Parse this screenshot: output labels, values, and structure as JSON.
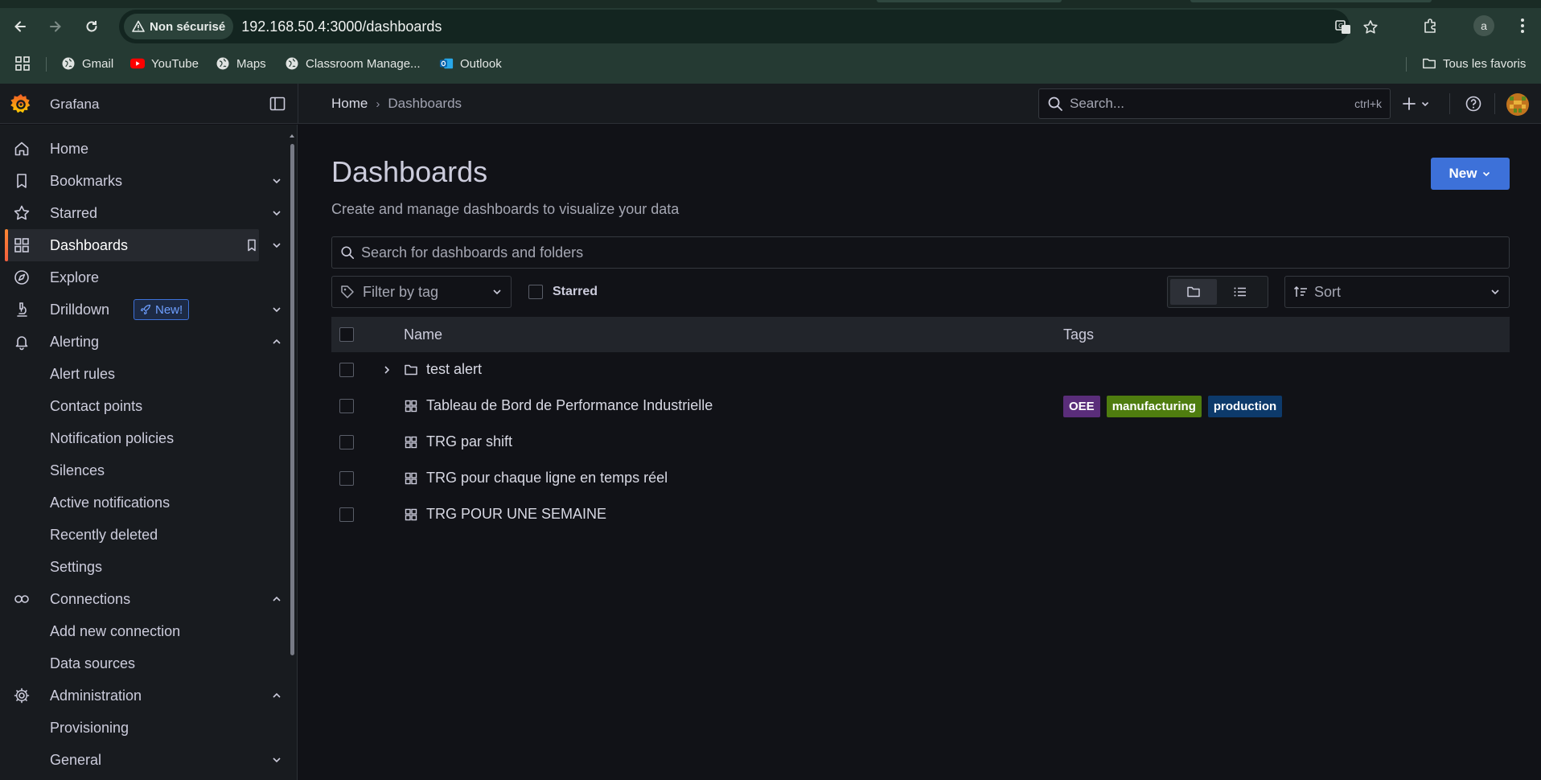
{
  "browser": {
    "security_label": "Non sécurisé",
    "url": "192.168.50.4:3000/dashboards",
    "profile_initial": "a",
    "bookmarks": [
      {
        "label": "Gmail",
        "icon": "globe-icon"
      },
      {
        "label": "YouTube",
        "icon": "youtube-icon"
      },
      {
        "label": "Maps",
        "icon": "globe-icon"
      },
      {
        "label": "Classroom Manage...",
        "icon": "globe-icon"
      },
      {
        "label": "Outlook",
        "icon": "outlook-icon"
      }
    ],
    "all_bookmarks_label": "Tous les favoris"
  },
  "grafana": {
    "app_name": "Grafana",
    "breadcrumb": {
      "home": "Home",
      "current": "Dashboards"
    },
    "search": {
      "placeholder": "Search...",
      "shortcut": "ctrl+k"
    },
    "accent_color": "#3d71d9"
  },
  "sidebar": {
    "items": [
      {
        "label": "Home",
        "icon": "home-icon"
      },
      {
        "label": "Bookmarks",
        "icon": "bookmark-icon"
      },
      {
        "label": "Starred",
        "icon": "star-icon"
      },
      {
        "label": "Dashboards",
        "icon": "apps-icon",
        "active": true
      },
      {
        "label": "Explore",
        "icon": "compass-icon"
      },
      {
        "label": "Drilldown",
        "icon": "microscope-icon",
        "badge": "New!"
      },
      {
        "label": "Alerting",
        "icon": "bell-icon"
      },
      {
        "label": "Connections",
        "icon": "connections-icon"
      },
      {
        "label": "Administration",
        "icon": "cog-icon"
      }
    ],
    "alerting_children": [
      "Alert rules",
      "Contact points",
      "Notification policies",
      "Silences",
      "Active notifications",
      "Recently deleted",
      "Settings"
    ],
    "connections_children": [
      "Add new connection",
      "Data sources"
    ],
    "administration_children": [
      "Provisioning",
      "General"
    ]
  },
  "main": {
    "title": "Dashboards",
    "subtitle": "Create and manage dashboards to visualize your data",
    "new_button": "New",
    "search_placeholder": "Search for dashboards and folders",
    "filter_by_tag": "Filter by tag",
    "starred_label": "Starred",
    "sort_label": "Sort",
    "columns": {
      "name": "Name",
      "tags": "Tags"
    },
    "rows": [
      {
        "type": "folder",
        "name": "test alert",
        "tags": []
      },
      {
        "type": "dashboard",
        "name": "Tableau de Bord de Performance Industrielle",
        "tags": [
          {
            "label": "OEE",
            "color": "#5a2d7a"
          },
          {
            "label": "manufacturing",
            "color": "#4f7d0f"
          },
          {
            "label": "production",
            "color": "#0d3a6b"
          }
        ]
      },
      {
        "type": "dashboard",
        "name": "TRG par shift",
        "tags": []
      },
      {
        "type": "dashboard",
        "name": "TRG pour chaque ligne en temps réel",
        "tags": []
      },
      {
        "type": "dashboard",
        "name": "TRG POUR UNE SEMAINE",
        "tags": []
      }
    ]
  }
}
